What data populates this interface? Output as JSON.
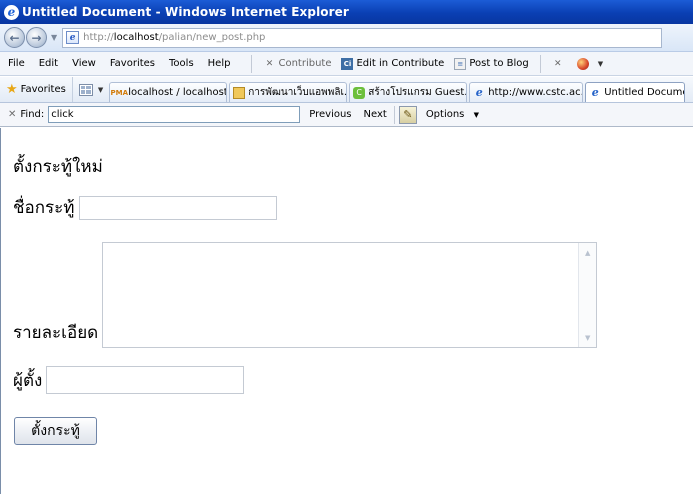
{
  "window": {
    "title": "Untitled Document - Windows Internet Explorer"
  },
  "address": {
    "prefix": "http://",
    "host": "localhost",
    "path": "/palian/new_post.php"
  },
  "menu": {
    "items": [
      "File",
      "Edit",
      "View",
      "Favorites",
      "Tools",
      "Help"
    ]
  },
  "toolbar": {
    "contribute": "Contribute",
    "edit_in_contribute": "Edit in Contribute",
    "post_to_blog": "Post to Blog"
  },
  "favorites": {
    "label": "Favorites",
    "tabs": [
      {
        "label": "localhost / localhost /..."
      },
      {
        "label": "การพัฒนาเว็บแอพพลิเ..."
      },
      {
        "label": "สร้างโปรแกรม Guest..."
      },
      {
        "label": "http://www.cstc.ac...."
      },
      {
        "label": "Untitled Document"
      }
    ]
  },
  "findbar": {
    "label": "Find:",
    "value": "click",
    "previous": "Previous",
    "next": "Next",
    "options": "Options"
  },
  "form": {
    "heading": "ตั้งกระทู้ใหม่",
    "title_label": "ชื่อกระทู้",
    "title_value": "",
    "detail_label": "รายละเอียด",
    "detail_value": "",
    "poster_label": "ผู้ตั้ง",
    "poster_value": "",
    "submit_label": "ตั้งกระทู้"
  }
}
